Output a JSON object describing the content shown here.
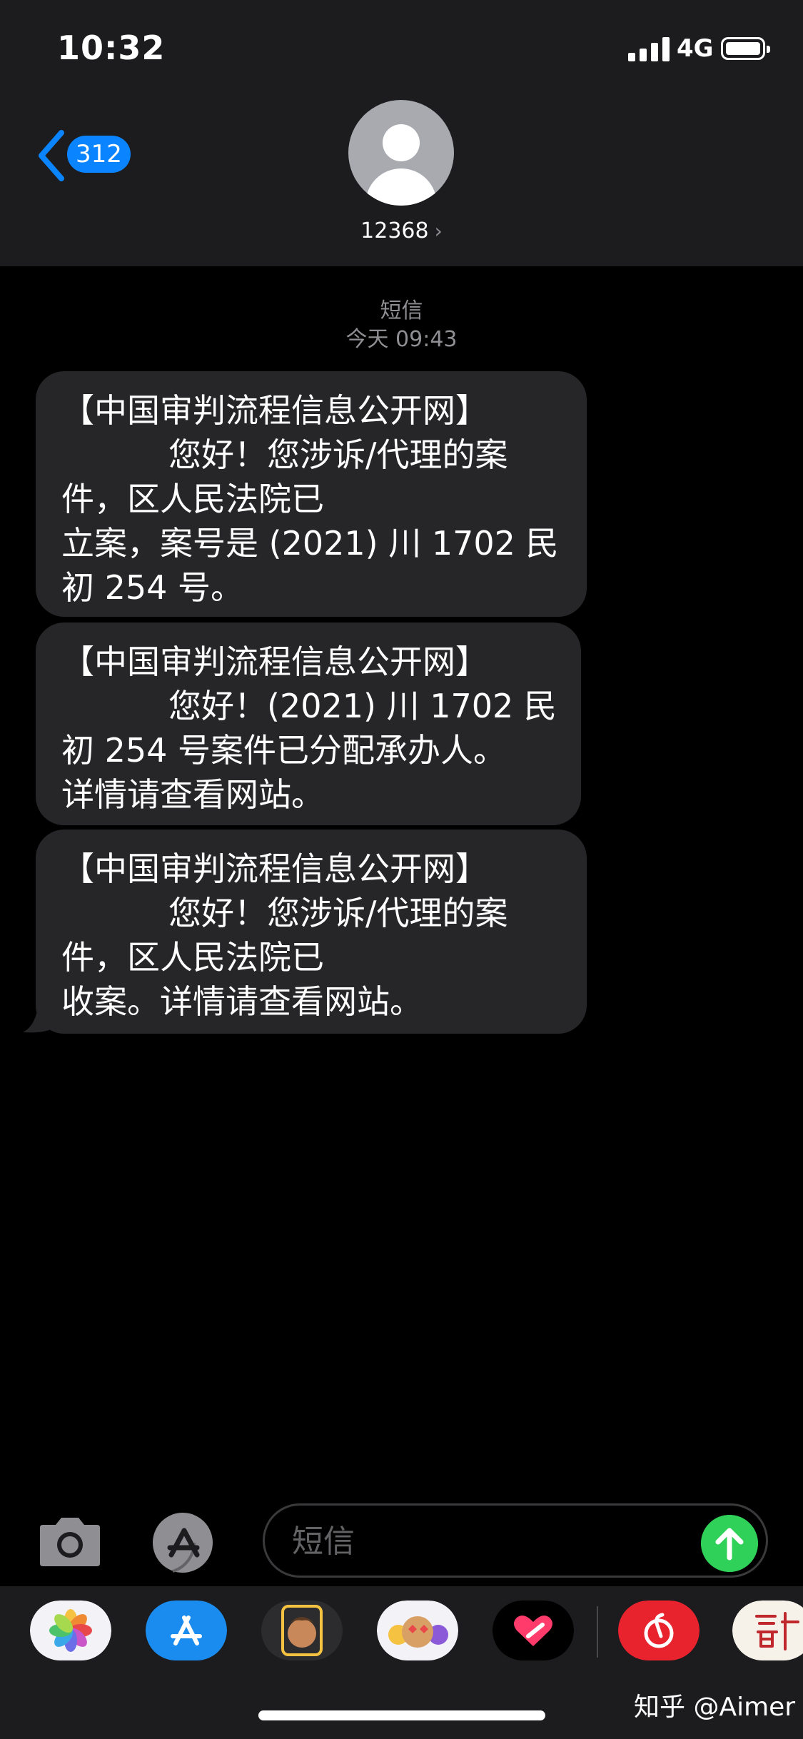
{
  "status_bar": {
    "time": "10:32",
    "network": "4G"
  },
  "header": {
    "unread_count": "312",
    "contact": "12368",
    "contact_chevron": "›"
  },
  "thread": {
    "channel": "短信",
    "timestamp": "今天 09:43",
    "messages": [
      {
        "lines": [
          "【中国审判流程信息公开网】",
          "您好！您涉诉/代理的案",
          "件，区人民法院已",
          "立案，案号是 (2021) 川 1702 民",
          "初 254 号。"
        ]
      },
      {
        "lines": [
          "【中国审判流程信息公开网】",
          "您好！(2021) 川 1702 民",
          "初 254 号案件已分配承办人。",
          "详情请查看网站。"
        ]
      },
      {
        "lines": [
          "【中国审判流程信息公开网】",
          "您好！您涉诉/代理的案",
          "件，区人民法院已",
          "收案。详情请查看网站。"
        ]
      }
    ]
  },
  "composer": {
    "placeholder": "短信"
  },
  "app_drawer": {
    "apps": [
      "photos-icon",
      "app-store-icon",
      "memoji-icon",
      "animoji-icon",
      "digital-touch-icon",
      "netease-music-icon",
      "calendar-seal-icon"
    ]
  },
  "watermark": "知乎 @Aimer",
  "colors": {
    "accent_blue": "#0a84ff",
    "send_green": "#30d158",
    "bubble": "#262628",
    "bar": "#1c1c1e"
  }
}
